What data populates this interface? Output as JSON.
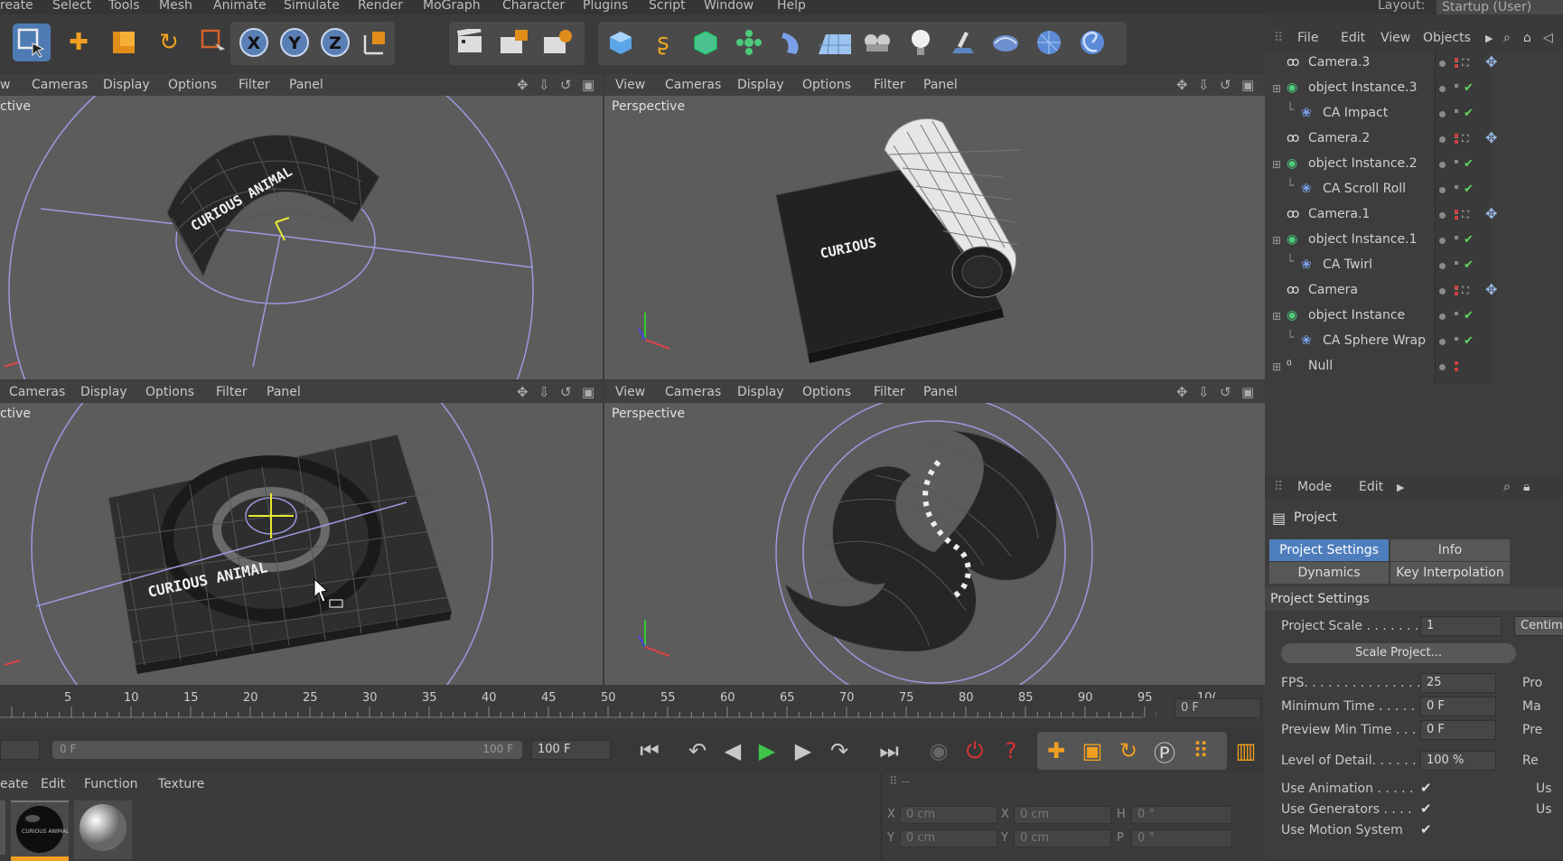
{
  "menu": [
    "reate",
    "Select",
    "Tools",
    "Mesh",
    "Animate",
    "Simulate",
    "Render",
    "MoGraph",
    "Character",
    "Plugins",
    "Script",
    "Window",
    "Help"
  ],
  "layout": {
    "label": "Layout:",
    "value": "Startup (User)"
  },
  "viewports": {
    "tl": {
      "menu": [
        "w",
        "Cameras",
        "Display",
        "Options",
        "Filter",
        "Panel"
      ],
      "label": "ctive",
      "text": "CURIOUS ANIMAL"
    },
    "tr": {
      "menu": [
        "View",
        "Cameras",
        "Display",
        "Options",
        "Filter",
        "Panel"
      ],
      "label": "Perspective",
      "text": "CURIOUS"
    },
    "bl": {
      "menu": [
        "Cameras",
        "Display",
        "Options",
        "Filter",
        "Panel"
      ],
      "label": "ctive",
      "text": "CURIOUS ANIMAL"
    },
    "br": {
      "menu": [
        "View",
        "Cameras",
        "Display",
        "Options",
        "Filter",
        "Panel"
      ],
      "label": "Perspective"
    }
  },
  "object_manager": {
    "menu": [
      "File",
      "Edit",
      "View",
      "Objects"
    ],
    "objects": [
      {
        "name": "Camera.3",
        "indent": 0,
        "icon": "camera-icon"
      },
      {
        "name": "object Instance.3",
        "indent": 0,
        "icon": "instance-icon"
      },
      {
        "name": "CA Impact",
        "indent": 1,
        "icon": "deformer-icon"
      },
      {
        "name": "Camera.2",
        "indent": 0,
        "icon": "camera-icon"
      },
      {
        "name": "object Instance.2",
        "indent": 0,
        "icon": "instance-icon"
      },
      {
        "name": "CA Scroll Roll",
        "indent": 1,
        "icon": "deformer-icon"
      },
      {
        "name": "Camera.1",
        "indent": 0,
        "icon": "camera-icon"
      },
      {
        "name": "object Instance.1",
        "indent": 0,
        "icon": "instance-icon"
      },
      {
        "name": "CA Twirl",
        "indent": 1,
        "icon": "deformer-icon"
      },
      {
        "name": "Camera",
        "indent": 0,
        "icon": "camera-icon"
      },
      {
        "name": "object Instance",
        "indent": 0,
        "icon": "instance-icon"
      },
      {
        "name": "CA Sphere Wrap",
        "indent": 1,
        "icon": "deformer-icon"
      },
      {
        "name": "Null",
        "indent": 0,
        "icon": "null-icon"
      }
    ]
  },
  "attributes": {
    "menu": [
      "Mode",
      "Edit"
    ],
    "title": "Project",
    "tabs": [
      "Project Settings",
      "Info",
      "Dynamics",
      "Key Interpolation"
    ],
    "section": "Project Settings",
    "project_scale": {
      "label": "Project Scale . . . . . . . .",
      "value": "1",
      "unit": "Centim"
    },
    "scale_button": "Scale Project...",
    "fields": [
      {
        "label": "FPS. . . . . . . . . . . . . . . . . .",
        "value": "25",
        "side": "Pro"
      },
      {
        "label": "Minimum Time . . . . . .",
        "value": "0 F",
        "side": "Ma"
      },
      {
        "label": "Preview Min Time . . .",
        "value": "0 F",
        "side": "Pre"
      },
      {
        "label": "Level of Detail. . . . . . .",
        "value": "100 %",
        "side": "Re"
      }
    ],
    "checks": [
      {
        "label": "Use Animation . . . . .",
        "side": "Us"
      },
      {
        "label": "Use Generators . . . .",
        "side": "Us"
      },
      {
        "label": "Use Motion System",
        "side": ""
      }
    ]
  },
  "timeline": {
    "ticks": [
      "5",
      "10",
      "15",
      "20",
      "25",
      "30",
      "35",
      "40",
      "45",
      "50",
      "55",
      "60",
      "65",
      "70",
      "75",
      "80",
      "85",
      "90",
      "95",
      "10("
    ],
    "current": "0 F",
    "range_start": "0 F",
    "range_end": "100 F",
    "end_field": "100 F"
  },
  "material": {
    "menu": [
      "eate",
      "Edit",
      "Function",
      "Texture"
    ]
  },
  "coords": {
    "x": "0 cm",
    "y": "0 cm",
    "x2": "0 cm",
    "y2": "0 cm",
    "h": "0 °",
    "p": "0 °"
  }
}
